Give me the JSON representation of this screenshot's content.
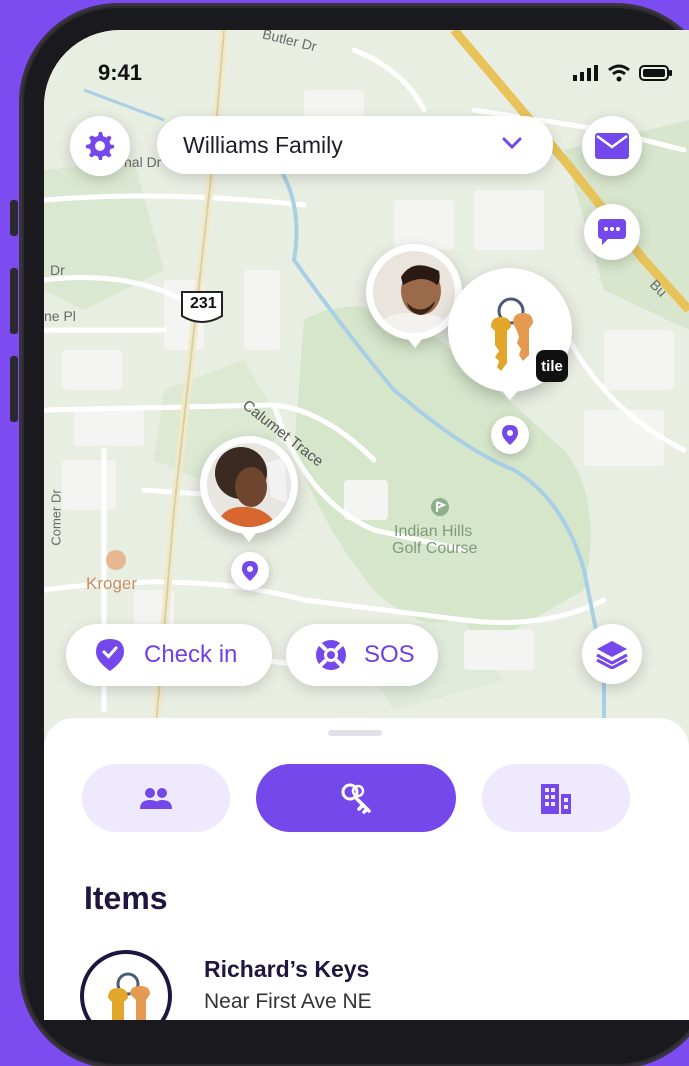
{
  "status": {
    "time": "9:41"
  },
  "header": {
    "family_name": "Williams Family"
  },
  "map": {
    "labels": {
      "butler": "Butler Dr",
      "nal": "nal Dr",
      "dr": "Dr",
      "pl": "ne Pl",
      "route": "231",
      "calumet": "Calumet Trace",
      "comer": "Comer Dr",
      "golf1": "Indian Hills",
      "golf2": "Golf Course",
      "kroger": "Kroger",
      "bu": "Bu"
    },
    "tile_badge": "tile"
  },
  "actions": {
    "check_in": "Check in",
    "sos": "SOS"
  },
  "sheet": {
    "items_title": "Items",
    "item": {
      "name": "Richard’s Keys",
      "location": "Near First Ave NE"
    }
  },
  "colors": {
    "brand": "#7448ea",
    "background": "#7d4cf0"
  }
}
